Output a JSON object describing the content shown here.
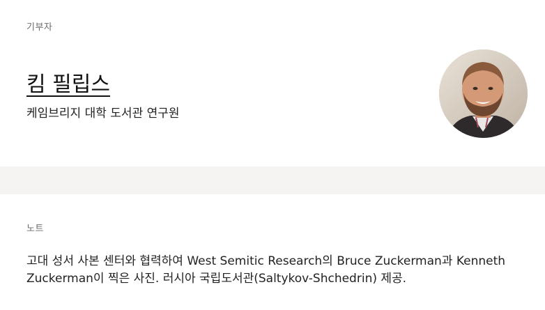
{
  "contributor": {
    "section_label": "기부자",
    "name": "킴 필립스",
    "affiliation": "케임브리지 대학 도서관 연구원",
    "avatar_icon": "person-photo"
  },
  "notes": {
    "section_label": "노트",
    "text": "고대 성서 사본 센터와 협력하여 West Semitic Research의 Bruce Zuckerman과 Kenneth Zuckerman이 찍은 사진. 러시아 국립도서관(Saltykov-Shchedrin) 제공."
  },
  "colors": {
    "band": "#f5f4f2",
    "label": "#6b6b6b",
    "text": "#222222"
  }
}
